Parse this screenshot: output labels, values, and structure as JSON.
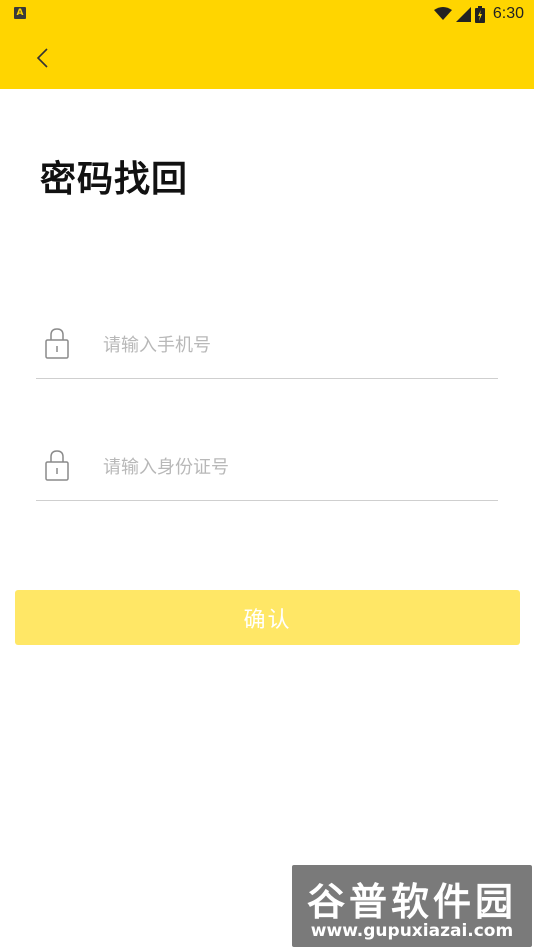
{
  "status_bar": {
    "app_indicator": "A",
    "time": "6:30",
    "icons": [
      "wifi-icon",
      "signal-icon",
      "battery-icon"
    ]
  },
  "header": {
    "back_icon": "chevron-left-icon",
    "accent_color": "#FFD500"
  },
  "page": {
    "title": "密码找回"
  },
  "form": {
    "phone": {
      "placeholder": "请输入手机号",
      "value": "",
      "icon": "lock-icon"
    },
    "id_card": {
      "placeholder": "请输入身份证号",
      "value": "",
      "icon": "lock-icon"
    },
    "confirm_label": "确认",
    "confirm_color": "#FFE766"
  },
  "watermark": {
    "title": "谷普软件园",
    "url": "www.gupuxiazai.com"
  }
}
